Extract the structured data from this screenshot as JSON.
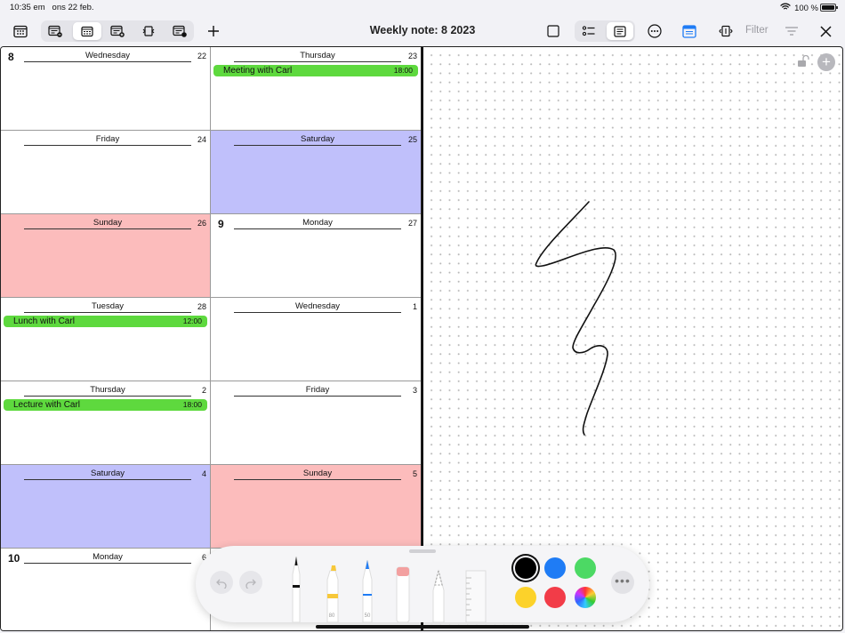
{
  "status_bar": {
    "time": "10:35 em",
    "date": "ons 22 feb.",
    "battery": "100 %"
  },
  "toolbar": {
    "title": "Weekly note: 8 2023",
    "filter_label": "Filter",
    "icons": [
      "calendar-icon",
      "calendar-remove-icon",
      "calendar-week-icon",
      "calendar-add-icon",
      "swap-icon",
      "calendar-info-icon",
      "plus-icon",
      "square-icon",
      "list-icon",
      "note-icon",
      "more-icon",
      "window-icon",
      "expand-icon",
      "filter-lines-icon",
      "close-icon"
    ]
  },
  "week": {
    "cells": [
      {
        "week": "8",
        "day": "Wednesday",
        "date": "22",
        "color": "#ffffff",
        "event": null
      },
      {
        "week": "",
        "day": "Thursday",
        "date": "23",
        "color": "#ffffff",
        "event": {
          "title": "Meeting with Carl",
          "time": "18:00"
        }
      },
      {
        "week": "",
        "day": "Friday",
        "date": "24",
        "color": "#ffffff",
        "event": null
      },
      {
        "week": "",
        "day": "Saturday",
        "date": "25",
        "color": "#c0c0fb",
        "event": null
      },
      {
        "week": "",
        "day": "Sunday",
        "date": "26",
        "color": "#fcbcbc",
        "event": null
      },
      {
        "week": "9",
        "day": "Monday",
        "date": "27",
        "color": "#ffffff",
        "event": null
      },
      {
        "week": "",
        "day": "Tuesday",
        "date": "28",
        "color": "#ffffff",
        "event": {
          "title": "Lunch with Carl",
          "time": "12:00"
        }
      },
      {
        "week": "",
        "day": "Wednesday",
        "date": "1",
        "color": "#ffffff",
        "event": null
      },
      {
        "week": "",
        "day": "Thursday",
        "date": "2",
        "color": "#ffffff",
        "event": {
          "title": "Lecture with Carl",
          "time": "18:00"
        }
      },
      {
        "week": "",
        "day": "Friday",
        "date": "3",
        "color": "#ffffff",
        "event": null
      },
      {
        "week": "",
        "day": "Saturday",
        "date": "4",
        "color": "#c0c0fb",
        "event": null
      },
      {
        "week": "",
        "day": "Sunday",
        "date": "5",
        "color": "#fcbcbc",
        "event": null
      },
      {
        "week": "10",
        "day": "Monday",
        "date": "6",
        "color": "#ffffff",
        "event": null
      }
    ],
    "event_color": "#5ed93e"
  },
  "palette": {
    "tools": [
      "pen-tool",
      "highlighter-tool",
      "pencil-tool",
      "eraser-tool",
      "lasso-tool",
      "ruler-tool"
    ],
    "tool_sizes": {
      "highlighter": "80",
      "pencil": "50"
    },
    "colors": [
      "#000000",
      "#1f7cf5",
      "#4cd964",
      "#fcd22a",
      "#f23c48",
      "rainbow"
    ],
    "selected_color": "#000000",
    "more_label": "•••"
  }
}
